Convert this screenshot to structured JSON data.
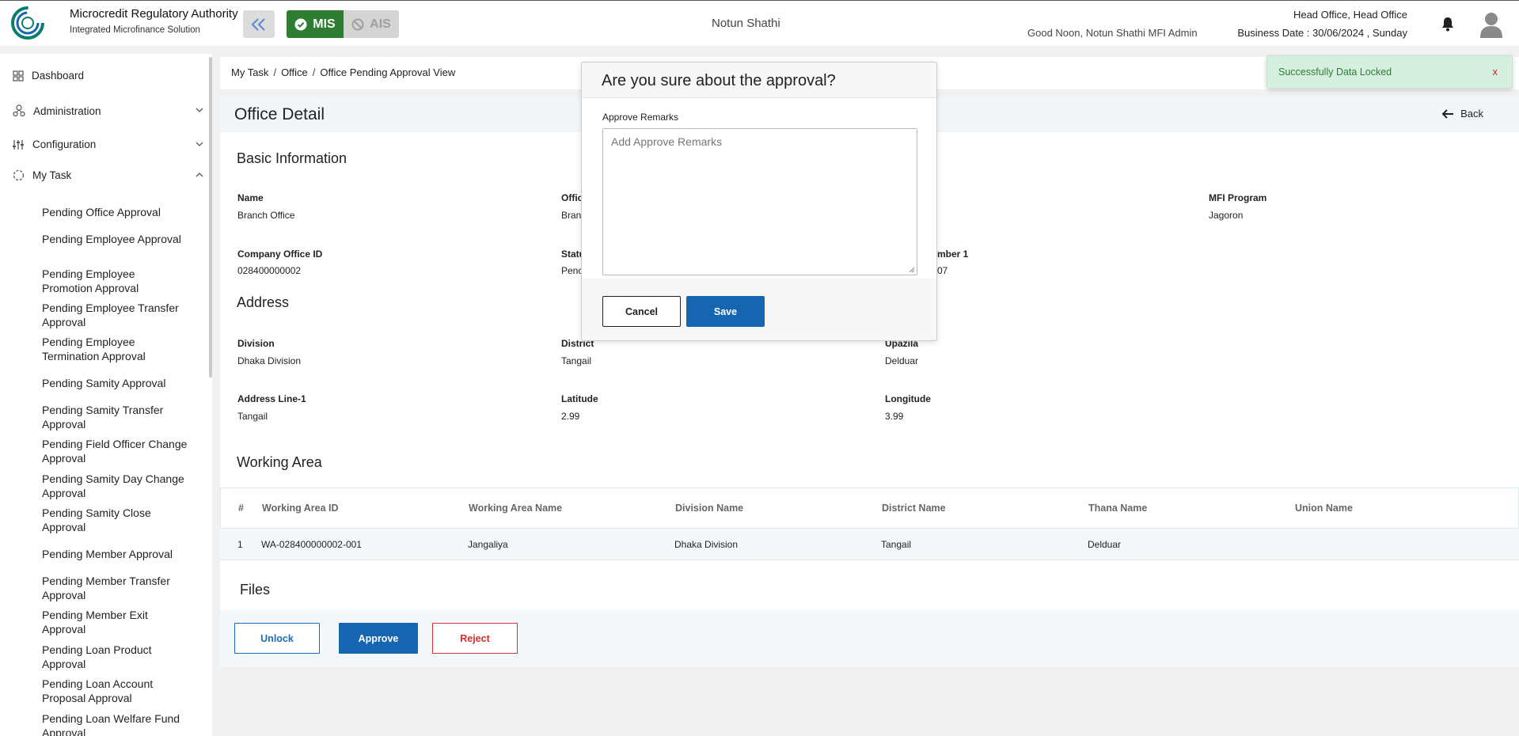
{
  "header": {
    "org_name": "Microcredit Regulatory Authority",
    "org_sub": "Integrated Microfinance Solution",
    "logo_text": "Microcredit Regulatory Authority",
    "mis_label": "MIS",
    "ais_label": "AIS",
    "mfi_name": "Notun Shathi",
    "greeting": "Good Noon, Notun Shathi MFI Admin",
    "head_office": "Head Office, Head Office",
    "business_date": "Business Date : 30/06/2024 , Sunday"
  },
  "sidebar": {
    "top_items": [
      {
        "label": "Dashboard",
        "icon": "grid-icon"
      },
      {
        "label": "Administration",
        "icon": "admin-icon"
      },
      {
        "label": "Configuration",
        "icon": "sliders-icon"
      },
      {
        "label": "My Task",
        "icon": "task-icon"
      }
    ],
    "sub_items": [
      "Pending Office Approval",
      "Pending Employee Approval",
      "Pending Employee Promotion Approval",
      "Pending Employee Transfer Approval",
      "Pending Employee Termination Approval",
      "Pending Samity Approval",
      "Pending Samity Transfer Approval",
      "Pending Field Officer Change Approval",
      "Pending Samity Day Change Approval",
      "Pending Samity Close Approval",
      "Pending Member Approval",
      "Pending Member Transfer Approval",
      "Pending Member Exit Approval",
      "Pending Loan Product Approval",
      "Pending Loan Account Proposal Approval",
      "Pending Loan Welfare Fund Approval"
    ]
  },
  "breadcrumb": [
    "My Task",
    "Office",
    "Office Pending Approval View"
  ],
  "page": {
    "title": "Office Detail",
    "back_label": "Back"
  },
  "basic_info": {
    "title": "Basic Information",
    "name_label": "Name",
    "name_value": "Branch Office",
    "office_type_label": "Offic",
    "office_type_value": "Bran",
    "mfi_program_label": "MFI Program",
    "mfi_program_value": "Jagoron",
    "company_office_id_label": "Company Office ID",
    "company_office_id_value": "028400000002",
    "status_label": "Statu",
    "status_value": "Penc",
    "number_label": "mber 1",
    "number_value": "07"
  },
  "address": {
    "title": "Address",
    "division_label": "Division",
    "division_value": "Dhaka Division",
    "district_label": "District",
    "district_value": "Tangail",
    "upazila_label": "Upazila",
    "upazila_value": "Delduar",
    "address_line_label": "Address Line-1",
    "address_line_value": "Tangail",
    "latitude_label": "Latitude",
    "latitude_value": "2.99",
    "longitude_label": "Longitude",
    "longitude_value": "3.99"
  },
  "working_area": {
    "title": "Working Area",
    "columns": [
      "#",
      "Working Area ID",
      "Working Area Name",
      "Division Name",
      "District Name",
      "Thana Name",
      "Union Name"
    ],
    "rows": [
      [
        "1",
        "WA-028400000002-001",
        "Jangaliya",
        "Dhaka Division",
        "Tangail",
        "Delduar",
        ""
      ]
    ]
  },
  "files": {
    "title": "Files",
    "unlock_label": "Unlock",
    "approve_label": "Approve",
    "reject_label": "Reject"
  },
  "modal": {
    "title": "Are you sure about the approval?",
    "remarks_label": "Approve Remarks",
    "remarks_placeholder": "Add Approve Remarks",
    "remarks_value": "",
    "cancel_label": "Cancel",
    "save_label": "Save"
  },
  "toast": {
    "message": "Successfully Data Locked",
    "close_label": "x"
  },
  "colors": {
    "mis_green": "#2e7d32",
    "primary_blue": "#1565b0",
    "reject_red": "#d32f2f",
    "toast_bg": "#d7efe0"
  }
}
